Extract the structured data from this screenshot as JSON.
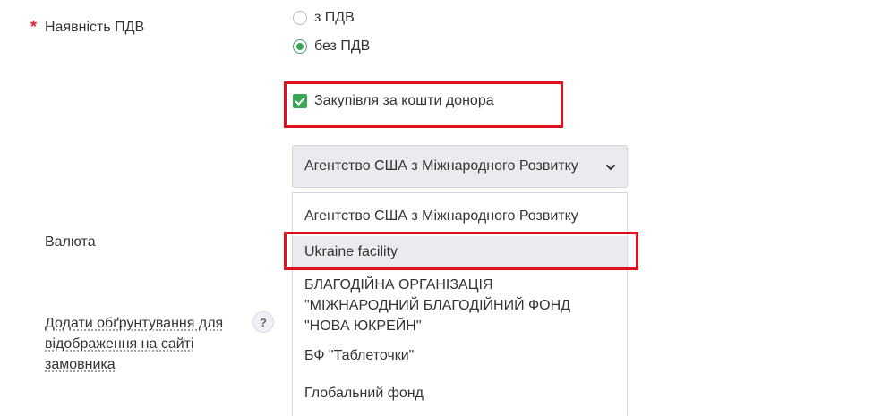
{
  "vat": {
    "required_mark": "*",
    "label": "Наявність ПДВ",
    "options": [
      {
        "label": "з ПДВ",
        "checked": false
      },
      {
        "label": "без ПДВ",
        "checked": true
      }
    ]
  },
  "donor_checkbox": {
    "label": "Закупівля за кошти донора",
    "checked": true
  },
  "donor_select": {
    "value": "Агентство США з Міжнародного Розвитку",
    "options": [
      "Агентство США з Міжнародного Розвитку",
      "Ukraine facility",
      "БЛАГОДІЙНА ОРГАНІЗАЦІЯ \"МІЖНАРОДНИЙ БЛАГОДІЙНИЙ ФОНД \"НОВА ЮКРЕЙН\"",
      "БФ \"Таблеточки\"",
      "Глобальний фонд"
    ],
    "option_lines": {
      "blago_1": "БЛАГОДІЙНА ОРГАНІЗАЦІЯ",
      "blago_2": "\"МІЖНАРОДНИЙ БЛАГОДІЙНИЙ ФОНД",
      "blago_3": "\"НОВА ЮКРЕЙН\""
    },
    "highlighted_option_index": 1
  },
  "currency": {
    "label": "Валюта"
  },
  "justification": {
    "label_lines": [
      "Додати обґрунтування для",
      "відображення на сайті",
      "замовника"
    ],
    "help_symbol": "?"
  },
  "colors": {
    "accent": "#3aa757",
    "highlight_box": "#e0101f",
    "required": "#e8212a"
  }
}
